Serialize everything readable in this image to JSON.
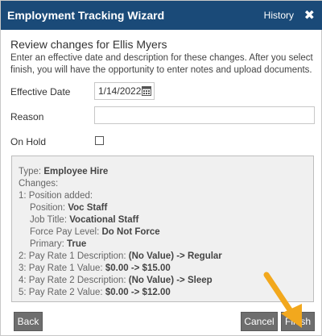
{
  "dialog": {
    "title": "Employment Tracking Wizard",
    "history_label": "History",
    "close_glyph": "✖"
  },
  "header": {
    "subtitle": "Review changes for Ellis Myers",
    "intro": "Enter an effective date and description for these changes. After you select finish, you will have the opportunity to enter notes and upload documents."
  },
  "form": {
    "effective_date_label": "Effective Date",
    "effective_date_value": "1/14/2022",
    "reason_label": "Reason",
    "reason_value": "",
    "on_hold_label": "On Hold",
    "on_hold_checked": false
  },
  "summary": {
    "type_label": "Type:",
    "type_value": "Employee Hire",
    "changes_label": "Changes:",
    "change1_label": "1: Position added:",
    "position_label": "Position:",
    "position_value": "Voc Staff",
    "job_title_label": "Job Title:",
    "job_title_value": "Vocational Staff",
    "force_pay_label": "Force Pay Level:",
    "force_pay_value": "Do Not Force",
    "primary_label": "Primary:",
    "primary_value": "True",
    "change2_label": "2: Pay Rate 1 Description:",
    "change2_value": "(No Value) -> Regular",
    "change3_label": "3: Pay Rate 1 Value:",
    "change3_value": "$0.00 -> $15.00",
    "change4_label": "4: Pay Rate 2 Description:",
    "change4_value": "(No Value) -> Sleep",
    "change5_label": "5: Pay Rate 2 Value:",
    "change5_value": "$0.00 -> $12.00"
  },
  "buttons": {
    "back": "Back",
    "cancel": "Cancel",
    "finish": "Finish"
  },
  "colors": {
    "titlebar": "#1a4a78",
    "button": "#6e6e6e",
    "arrow": "#f2a81d"
  }
}
